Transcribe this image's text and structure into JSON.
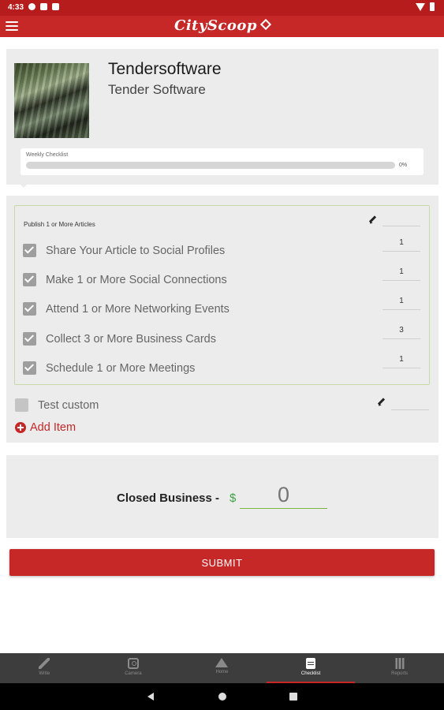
{
  "status_bar": {
    "time": "4:33"
  },
  "app_bar": {
    "title": "CityScoop"
  },
  "profile": {
    "name": "Tendersoftware",
    "company": "Tender Software",
    "progress": {
      "label": "Weekly Checklist",
      "value_text": "0%",
      "value": 0
    }
  },
  "checklist": {
    "group_title": "Publish 1 or More Articles",
    "group_count": "",
    "items": [
      {
        "label": "Share Your Article to Social Profiles",
        "count": "1",
        "checked": true
      },
      {
        "label": "Make 1 or More Social Connections",
        "count": "1",
        "checked": true
      },
      {
        "label": "Attend 1 or More Networking Events",
        "count": "1",
        "checked": true
      },
      {
        "label": "Collect 3 or More Business Cards",
        "count": "3",
        "checked": true
      },
      {
        "label": "Schedule 1 or More Meetings",
        "count": "1",
        "checked": true
      }
    ],
    "custom_item": {
      "label": "Test custom",
      "count": "",
      "checked": false
    },
    "add_item_label": "Add Item"
  },
  "business": {
    "label": "Closed Business -",
    "currency": "$",
    "placeholder": "0"
  },
  "submit_label": "SUBMIT",
  "bottom_nav": [
    {
      "label": "Write",
      "icon": "pencil-icon"
    },
    {
      "label": "Camera",
      "icon": "camera-icon"
    },
    {
      "label": "Home",
      "icon": "home-icon"
    },
    {
      "label": "Checklist",
      "icon": "clipboard-icon",
      "active": true
    },
    {
      "label": "Reports",
      "icon": "bar-chart-icon"
    }
  ],
  "colors": {
    "primary": "#c62828",
    "accent_green": "#43a047",
    "card_bg": "#ececec"
  }
}
